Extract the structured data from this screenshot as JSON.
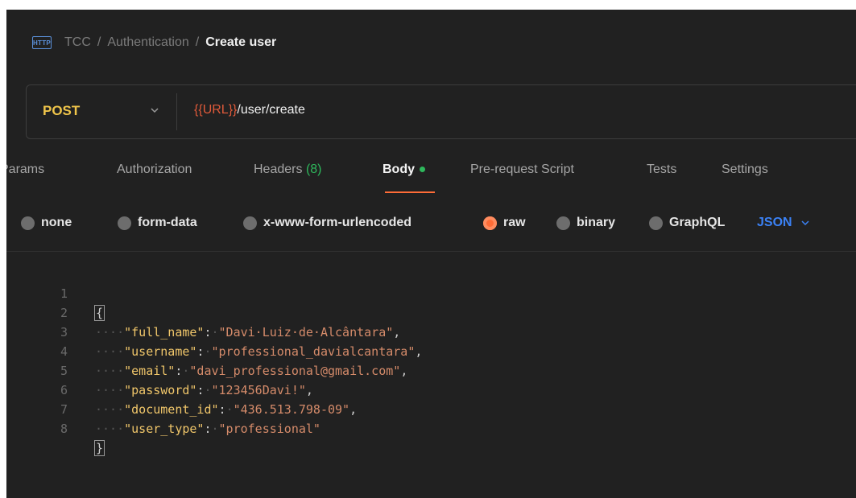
{
  "breadcrumb": {
    "icon_label": "HTTP",
    "items": [
      "TCC",
      "Authentication"
    ],
    "separator": "/",
    "current": "Create user"
  },
  "request": {
    "method": "POST",
    "url_variable": "{{URL}}",
    "url_path": "/user/create"
  },
  "tabs": [
    {
      "label": "Params"
    },
    {
      "label": "Authorization"
    },
    {
      "label": "Headers",
      "count": "(8)"
    },
    {
      "label": "Body",
      "active": true
    },
    {
      "label": "Pre-request Script"
    },
    {
      "label": "Tests"
    },
    {
      "label": "Settings"
    }
  ],
  "body_types": [
    "none",
    "form-data",
    "x-www-form-urlencoded",
    "raw",
    "binary",
    "GraphQL"
  ],
  "selected_body_type": "raw",
  "format": "JSON",
  "editor": {
    "line_numbers": [
      "1",
      "2",
      "3",
      "4",
      "5",
      "6",
      "7",
      "8"
    ],
    "open_brace": "{",
    "close_brace": "}",
    "fields": [
      {
        "key": "\"full_name\"",
        "value": "\"Davi·Luiz·de·Alcântara\"",
        "comma": ","
      },
      {
        "key": "\"username\"",
        "value": "\"professional_davialcantara\"",
        "comma": ","
      },
      {
        "key": "\"email\"",
        "value": "\"davi_professional@gmail.com\"",
        "comma": ","
      },
      {
        "key": "\"password\"",
        "value": "\"123456Davi!\"",
        "comma": ","
      },
      {
        "key": "\"document_id\"",
        "value": "\"436.513.798-09\"",
        "comma": ","
      },
      {
        "key": "\"user_type\"",
        "value": "\"professional\"",
        "comma": ""
      }
    ],
    "indent": "····",
    "colon": ":",
    "space": "·"
  },
  "colors": {
    "background": "#212121",
    "method": "#f0c54a",
    "accent": "#ff6c37",
    "variable": "#e05a3a",
    "green": "#2eb85c",
    "json_blue": "#3b82f6"
  }
}
